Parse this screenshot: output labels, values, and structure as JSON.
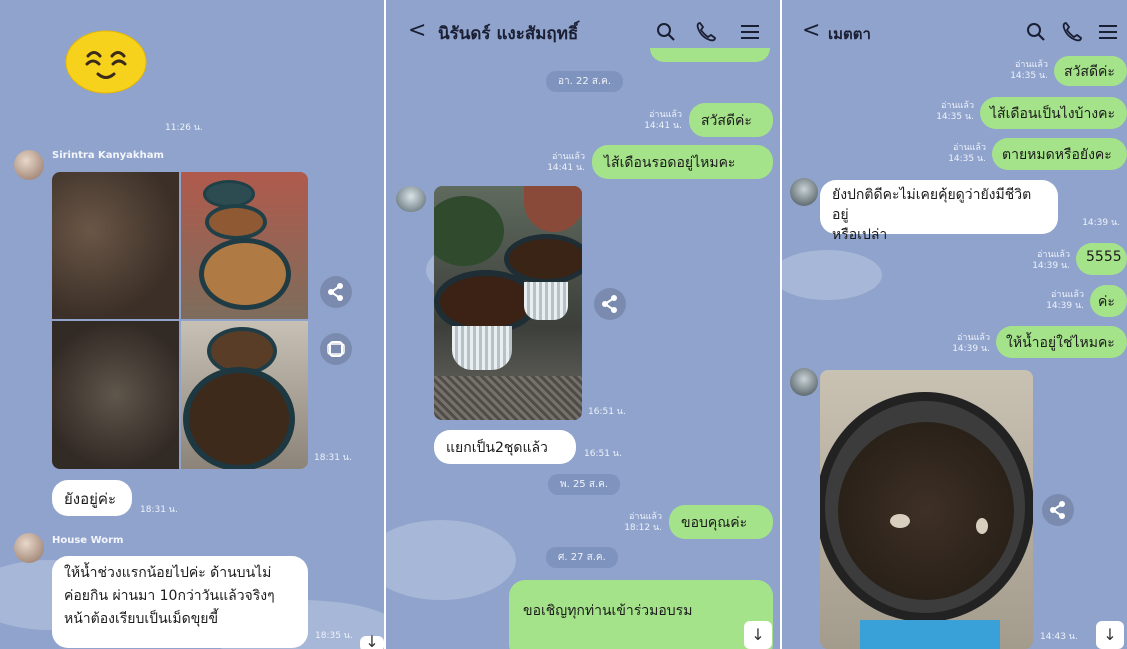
{
  "left": {
    "time_emoji": "11:26 น.",
    "sender1": "Sirintra Kanyakham",
    "time_photos": "18:31 น.",
    "reply": "ยังอยู่ค่ะ",
    "time_reply": "18:31 น.",
    "sender2": "House Worm",
    "msg_line1": "ให้น้ำช่วงแรกน้อยไปค่ะ ด้านบนไม่",
    "msg_line2": "ค่อยกิน ผ่านมา 10กว่าวันแล้วจริงๆ",
    "msg_line3": "หน้าต้องเรียบเป็นเม็ดขุยขี้",
    "time_msg": "18:35 น."
  },
  "middle": {
    "title": "นิรันดร์ แงะสัมฤทธิ์",
    "date1": "อา. 22 ส.ค.",
    "read": "อ่านแล้ว",
    "t1": "14:41 น.",
    "m1": "สวัสดีค่ะ",
    "t2": "14:41 น.",
    "m2": "ไส้เดือนรอดอยู่ไหมคะ",
    "t_photo": "16:51 น.",
    "m3": "แยกเป็น2ชุดแล้ว",
    "t3": "16:51 น.",
    "date2": "พ. 25 ส.ค.",
    "t4": "18:12 น.",
    "m4": "ขอบคุณค่ะ",
    "date3": "ศ. 27 ส.ค.",
    "m5": "ขอเชิญทุกท่านเข้าร่วมอบรม"
  },
  "right": {
    "title": "เมตตา",
    "read": "อ่านแล้ว",
    "t1": "14:35 น.",
    "m1": "สวัสดีค่ะ",
    "t2": "14:35 น.",
    "m2": "ไส้เดือนเป็นไงบ้างคะ",
    "t3": "14:35 น.",
    "m3": "ตายหมดหรือยังคะ",
    "in_line1": "ยังปกติดีคะไม่เคยคุ้ยดูว่ายังมีชีวิตอยู่",
    "in_line2": "หรือเปล่า",
    "t_in": "14:39 น.",
    "t4": "14:39 น.",
    "m4": "5555",
    "t5": "14:39 น.",
    "m5": "ค่ะ",
    "t6": "14:39 น.",
    "m6": "ให้น้ำอยู่ใช่ไหมคะ",
    "t_photo": "14:43 น."
  },
  "icons": [
    "smiley-sticker",
    "share-icon",
    "keep-icon",
    "back-chevron-icon",
    "search-icon",
    "phone-icon",
    "menu-icon",
    "scroll-down-icon"
  ],
  "colors": {
    "chat_bg": "#8fa3cc",
    "outgoing_bubble": "#a5e38a",
    "incoming_bubble": "#ffffff"
  }
}
